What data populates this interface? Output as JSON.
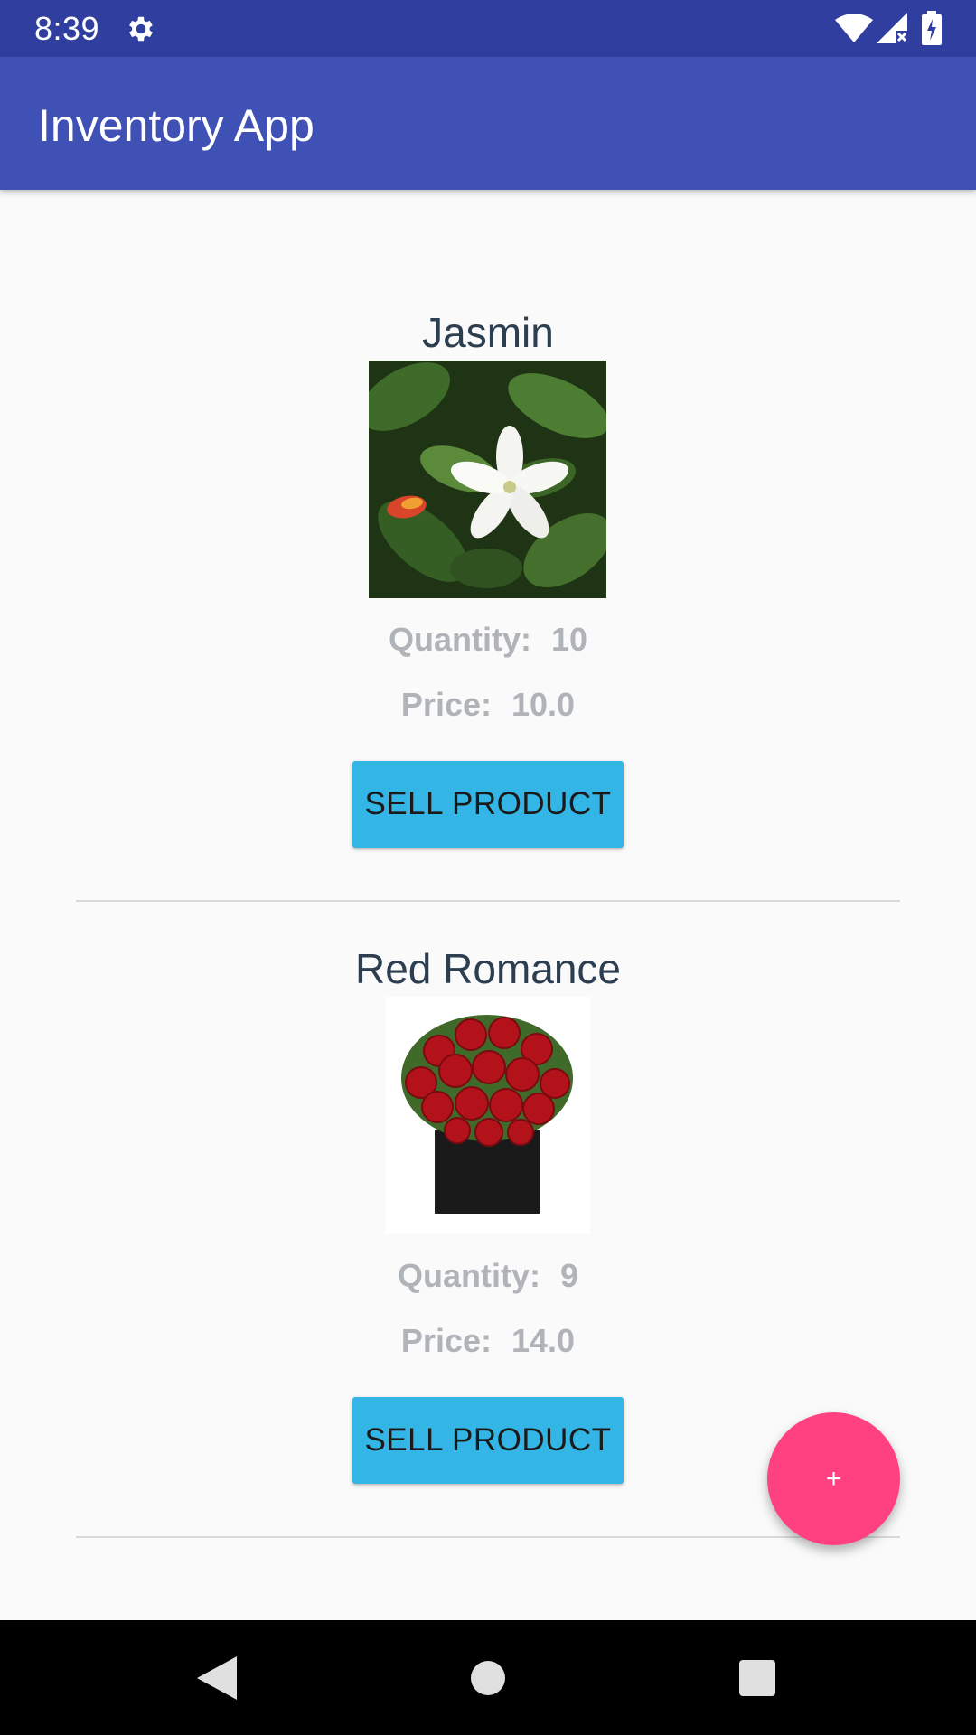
{
  "status_bar": {
    "time": "8:39",
    "icons": [
      "settings-gear-icon",
      "wifi-icon",
      "signal-no-sim-icon",
      "battery-charging-icon"
    ]
  },
  "app_bar": {
    "title": "Inventory App"
  },
  "products": [
    {
      "name": "Jasmin",
      "image": "jasmine-flower-photo",
      "quantity_label": "Quantity:",
      "quantity": "10",
      "price_label": "Price:",
      "price": "10.0",
      "button_label": "SELL PRODUCT"
    },
    {
      "name": "Red Romance",
      "image": "red-roses-bouquet-photo",
      "quantity_label": "Quantity:",
      "quantity": "9",
      "price_label": "Price:",
      "price": "14.0",
      "button_label": "SELL PRODUCT"
    }
  ],
  "fab": {
    "label": "+",
    "icon": "add-icon"
  },
  "nav_bar": {
    "icons": [
      "back-icon",
      "home-icon",
      "recents-icon"
    ]
  },
  "colors": {
    "status_bar": "#303f9f",
    "app_bar": "#3f51b5",
    "button": "#33b5e5",
    "fab": "#ff4081",
    "background": "#fafafa"
  }
}
